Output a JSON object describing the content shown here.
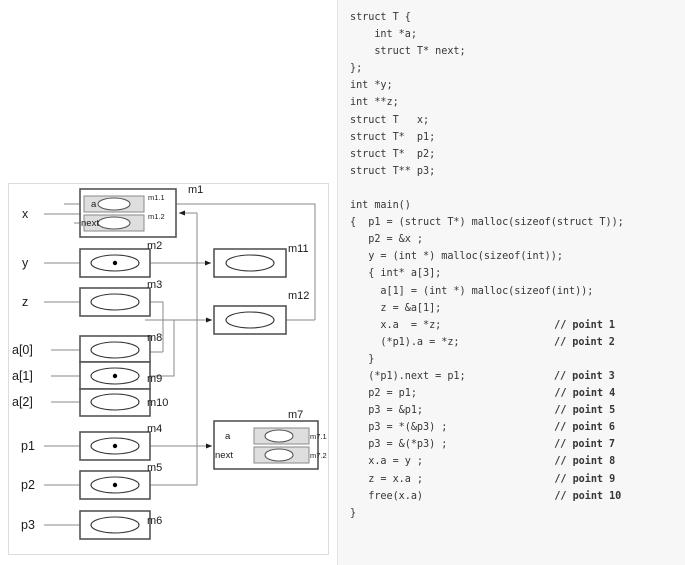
{
  "code": {
    "language": "c",
    "lines": [
      {
        "text": "struct T {",
        "comment": ""
      },
      {
        "text": "    int *a;",
        "comment": ""
      },
      {
        "text": "    struct T* next;",
        "comment": ""
      },
      {
        "text": "};",
        "comment": ""
      },
      {
        "text": "int *y;",
        "comment": ""
      },
      {
        "text": "int **z;",
        "comment": ""
      },
      {
        "text": "struct T   x;",
        "comment": ""
      },
      {
        "text": "struct T*  p1;",
        "comment": ""
      },
      {
        "text": "struct T*  p2;",
        "comment": ""
      },
      {
        "text": "struct T** p3;",
        "comment": ""
      },
      {
        "text": "",
        "comment": ""
      },
      {
        "text": "int main()",
        "comment": ""
      },
      {
        "text": "{  p1 = (struct T*) malloc(sizeof(struct T));",
        "comment": ""
      },
      {
        "text": "   p2 = &x ;",
        "comment": ""
      },
      {
        "text": "   y = (int *) malloc(sizeof(int));",
        "comment": ""
      },
      {
        "text": "   { int* a[3];",
        "comment": ""
      },
      {
        "text": "     a[1] = (int *) malloc(sizeof(int));",
        "comment": ""
      },
      {
        "text": "     z = &a[1];",
        "comment": ""
      },
      {
        "text": "     x.a  = *z;",
        "comment": "// point 1"
      },
      {
        "text": "     (*p1).a = *z;",
        "comment": "// point 2"
      },
      {
        "text": "   }",
        "comment": ""
      },
      {
        "text": "   (*p1).next = p1;",
        "comment": "// point 3"
      },
      {
        "text": "   p2 = p1;",
        "comment": "// point 4"
      },
      {
        "text": "   p3 = &p1;",
        "comment": "// point 5"
      },
      {
        "text": "   p3 = *(&p3) ;",
        "comment": "// point 6"
      },
      {
        "text": "   p3 = &(*p3) ;",
        "comment": "// point 7"
      },
      {
        "text": "   x.a = y ;",
        "comment": "// point 8"
      },
      {
        "text": "   z = x.a ;",
        "comment": "// point 9"
      },
      {
        "text": "   free(x.a)",
        "comment": "// point 10"
      },
      {
        "text": "}",
        "comment": ""
      }
    ],
    "comment_column": 205,
    "background_color": "#f7f7f7",
    "text_color": "#33373b"
  },
  "diagram": {
    "title": "memory cell pointer diagram",
    "variables": [
      {
        "name": "x",
        "cell": "m1",
        "kind": "struct",
        "value": null
      },
      {
        "name": "y",
        "cell": "m2",
        "kind": "pointer",
        "value": "set"
      },
      {
        "name": "z",
        "cell": "m3",
        "kind": "pointer",
        "value": "edge"
      },
      {
        "name": "a[0]",
        "cell": "m8",
        "kind": "pointer",
        "value": null
      },
      {
        "name": "a[1]",
        "cell": "m9",
        "kind": "pointer",
        "value": "set"
      },
      {
        "name": "a[2]",
        "cell": "m10",
        "kind": "pointer",
        "value": null
      },
      {
        "name": "p1",
        "cell": "m4",
        "kind": "pointer",
        "value": "set"
      },
      {
        "name": "p2",
        "cell": "m5",
        "kind": "pointer",
        "value": "set"
      },
      {
        "name": "p3",
        "cell": "m6",
        "kind": "pointer",
        "value": null
      }
    ],
    "struct_cells": [
      {
        "cell": "m1",
        "fields": [
          {
            "label": "a",
            "sub_cell": "m1.1"
          },
          {
            "label": "next",
            "sub_cell": "m1.2"
          }
        ]
      },
      {
        "cell": "m7",
        "fields": [
          {
            "label": "a",
            "sub_cell": "m7.1"
          },
          {
            "label": "next",
            "sub_cell": "m7.2"
          }
        ]
      }
    ],
    "heap_cells": [
      {
        "cell": "m11"
      },
      {
        "cell": "m12"
      }
    ],
    "labels": {
      "m1": "m1",
      "m1_1": "m1.1",
      "m1_2": "m1.2",
      "m2": "m2",
      "m3": "m3",
      "m4": "m4",
      "m5": "m5",
      "m6": "m6",
      "m7": "m7",
      "m7_1": "m7.1",
      "m7_2": "m7.2",
      "m8": "m8",
      "m9": "m9",
      "m10": "m10",
      "m11": "m11",
      "m12": "m12",
      "field_a": "a",
      "field_next": "next"
    },
    "edges": [
      {
        "from": "m1.1",
        "to": "m12"
      },
      {
        "from": "m2",
        "to": "m11"
      },
      {
        "from": "m3",
        "to": "m9"
      },
      {
        "from": "m9",
        "to": "m12"
      },
      {
        "from": "m4",
        "to": "m7"
      },
      {
        "from": "m5",
        "to": "m1"
      }
    ],
    "colors": {
      "box_stroke": "#555555",
      "sub_box_fill": "#dedede",
      "line": "#8a8a8a",
      "arrow": "#1a1a1a",
      "frame": "#dcdcdc"
    }
  }
}
